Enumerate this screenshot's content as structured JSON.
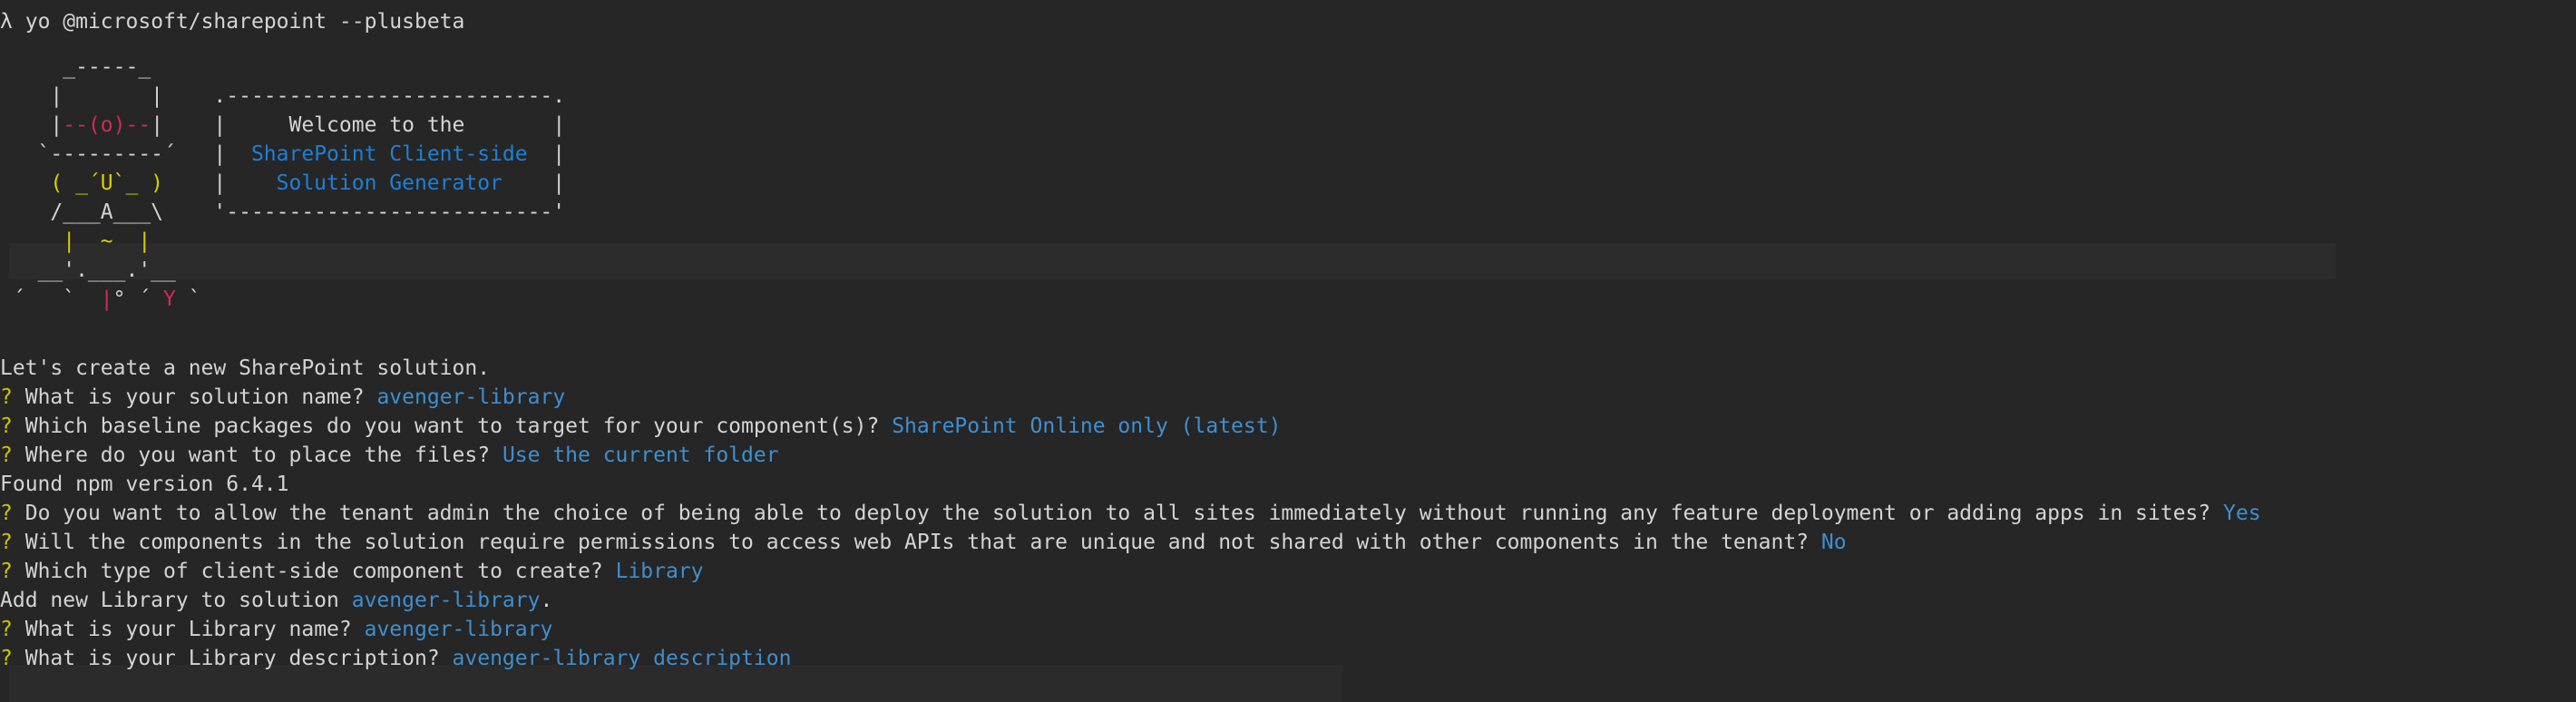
{
  "prompt": {
    "symbol": "λ",
    "command": "yo @microsoft/sharepoint --plusbeta"
  },
  "logo": {
    "welcome": "Welcome to the",
    "line2": "SharePoint Client-side",
    "line3": "Solution Generator"
  },
  "intro": "Let's create a new SharePoint solution.",
  "questions": [
    {
      "q": "What is your solution name?",
      "a": "avenger-library"
    },
    {
      "q": "Which baseline packages do you want to target for your component(s)?",
      "a": "SharePoint Online only (latest)"
    },
    {
      "q": "Where do you want to place the files?",
      "a": "Use the current folder"
    }
  ],
  "npm_note": "Found npm version 6.4.1",
  "questions2": [
    {
      "q": "Do you want to allow the tenant admin the choice of being able to deploy the solution to all sites immediately without running any feature deployment or adding apps in sites?",
      "a": "Yes"
    },
    {
      "q": "Will the components in the solution require permissions to access web APIs that are unique and not shared with other components in the tenant?",
      "a": "No"
    },
    {
      "q": "Which type of client-side component to create?",
      "a": "Library"
    }
  ],
  "add_note_prefix": "Add new Library to solution",
  "add_note_name": "avenger-library",
  "add_note_suffix": ".",
  "questions3": [
    {
      "q": "What is your Library name?",
      "a": "avenger-library"
    },
    {
      "q": "What is your Library description?",
      "a": "avenger-library description"
    }
  ],
  "qmark": "?",
  "colors": {
    "background": "#262626",
    "question_mark": "#c7c700",
    "answer": "#3f8fd0",
    "logo_red": "#d12a5a",
    "logo_yellow": "#d9d000",
    "logo_blue": "#1e7fd8"
  }
}
